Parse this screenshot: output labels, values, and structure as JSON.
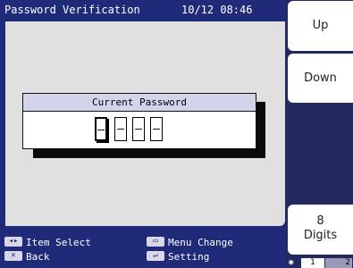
{
  "header": {
    "title": "Password Verification",
    "datetime": "10/12 08:46"
  },
  "dialog": {
    "title": "Current Password",
    "digits": [
      "–",
      "–",
      "–",
      "–"
    ]
  },
  "hints": {
    "item_select": "Item Select",
    "back": "Back",
    "menu_change": "Menu Change",
    "setting": "Setting"
  },
  "side_buttons": {
    "up": "Up",
    "down": "Down",
    "digits_line1": "8",
    "digits_line2": "Digits"
  },
  "pager": {
    "current": "1",
    "next": "2"
  },
  "icons": {
    "item_select": "left-right-arrows-icon",
    "back": "back-x-icon",
    "menu_change": "menu-icon",
    "setting": "enter-icon"
  }
}
